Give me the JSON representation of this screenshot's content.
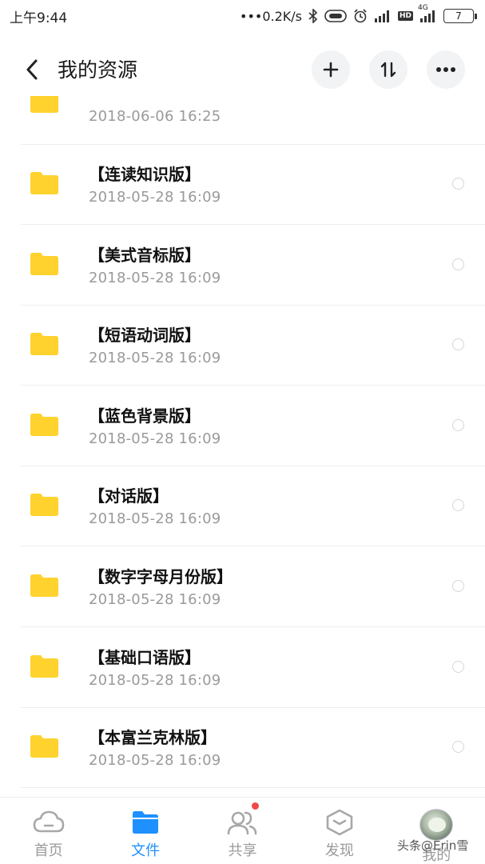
{
  "status_bar": {
    "time": "上午9:44",
    "net_speed": "•••0.2K/s",
    "hd_badge": "HD",
    "network_type": "4G",
    "battery": "7"
  },
  "header": {
    "title": "我的资源"
  },
  "files": [
    {
      "name": "",
      "date": "2018-06-06  16:25"
    },
    {
      "name": "【连读知识版】",
      "date": "2018-05-28  16:09"
    },
    {
      "name": "【美式音标版】",
      "date": "2018-05-28  16:09"
    },
    {
      "name": "【短语动词版】",
      "date": "2018-05-28  16:09"
    },
    {
      "name": "【蓝色背景版】",
      "date": "2018-05-28  16:09"
    },
    {
      "name": "【对话版】",
      "date": "2018-05-28  16:09"
    },
    {
      "name": "【数字字母月份版】",
      "date": "2018-05-28  16:09"
    },
    {
      "name": "【基础口语版】",
      "date": "2018-05-28  16:09"
    },
    {
      "name": "【本富兰克林版】",
      "date": "2018-05-28  16:09"
    }
  ],
  "nav": {
    "home": "首页",
    "files": "文件",
    "share": "共享",
    "discover": "发现",
    "mine": "我的"
  },
  "colors": {
    "folder": "#FFD22E",
    "accent": "#1E90FF",
    "date_gray": "#9A9A9A",
    "notification": "#F04848"
  },
  "watermark": "头条@Erin雪"
}
